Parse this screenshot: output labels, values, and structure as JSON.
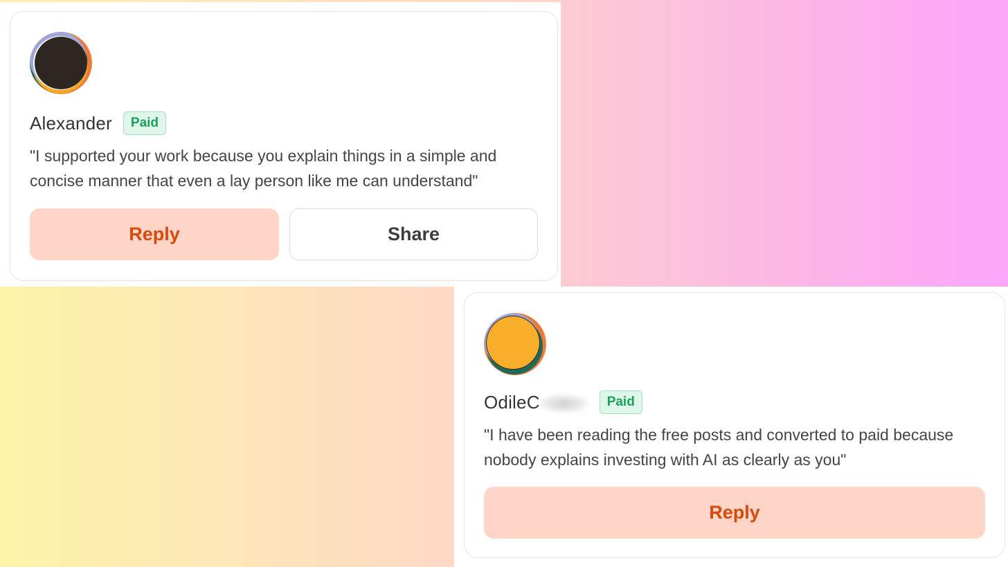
{
  "comments": [
    {
      "name": "Alexander",
      "badge": "Paid",
      "quote": "\"I supported your work because you explain things in a simple and concise manner that even a lay person like me can understand\"",
      "reply_label": "Reply",
      "share_label": "Share",
      "avatar_colors": [
        "#2e2621",
        "#f5a623",
        "#ed7a3b",
        "#1e6b55",
        "#9ea7d8"
      ]
    },
    {
      "name": "OdileC",
      "badge": "Paid",
      "quote": "\"I have been reading the free posts and converted to paid because nobody explains investing with AI as clearly as you\"",
      "reply_label": "Reply",
      "avatar_colors": [
        "#f8ad2b",
        "#ed7a3b",
        "#1e6b55",
        "#2e2621",
        "#9ea7d8"
      ]
    }
  ]
}
